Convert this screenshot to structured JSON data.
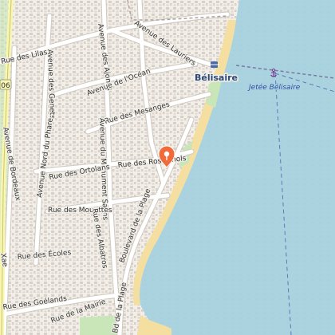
{
  "map": {
    "streets": {
      "lilas": "Rue des Lilas",
      "lauriers": "Avenue des Lauriers",
      "ajoncs": "Avenue des Ajoncs",
      "genets": "Avenue des Genets",
      "ocean": "Avenue de l'Océan",
      "mesanges": "Rue des Mesanges",
      "monument": "Avenue du Monument Salins",
      "nord_phare": "Avenue Nord du Phare",
      "bordeaux": "Avenue de Bordeaux",
      "ortolans": "Rue des Ortolans",
      "rossignols": "Rue des Rossignols",
      "mouettes": "Rue des Mouettes",
      "albatros": "Rue des Albatros",
      "boulevard_plage": "Boulevard de la Plage",
      "ecoles": "Rue des Écoles",
      "goelands": "Rue des Goélands",
      "mairie": "Rue de la Mairie",
      "bd_plage_bottom": "Bd de la Plage"
    },
    "road_number": "06",
    "cut_label": "Xae",
    "place_name": "Bélisaire",
    "jetty_label": "Jetée Bélisaire",
    "colors": {
      "land": "#f2efe9",
      "water": "#aad3df",
      "sand": "#f5dfa0",
      "park": "#c8e6b8",
      "building": "#d9d0c9",
      "marker": "#f06a3a"
    },
    "icons": [
      "map-pin-icon",
      "anchor-icon",
      "ferry-icon"
    ]
  }
}
